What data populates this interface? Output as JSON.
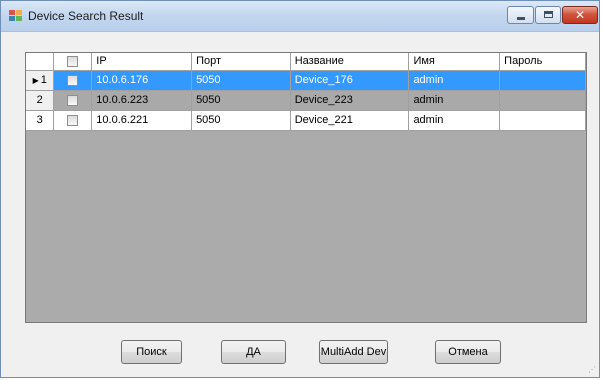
{
  "window": {
    "title": "Device Search Result",
    "close_glyph": "✕"
  },
  "grid": {
    "columns": [
      "IP",
      "Порт",
      "Название",
      "Имя",
      "Пароль"
    ],
    "rows": [
      {
        "num": "1",
        "ip": "10.0.6.176",
        "port": "5050",
        "name": "Device_176",
        "user": "admin",
        "password": "",
        "selected": true
      },
      {
        "num": "2",
        "ip": "10.0.6.223",
        "port": "5050",
        "name": "Device_223",
        "user": "admin",
        "password": ""
      },
      {
        "num": "3",
        "ip": "10.0.6.221",
        "port": "5050",
        "name": "Device_221",
        "user": "admin",
        "password": ""
      }
    ],
    "current_row_marker": "▶"
  },
  "buttons": {
    "search": "Поиск",
    "ok": "ДА",
    "multi_add": "MultiAdd Dev",
    "cancel": "Отмена"
  },
  "colors": {
    "selection": "#3399ff",
    "grid_background": "#ababab"
  }
}
